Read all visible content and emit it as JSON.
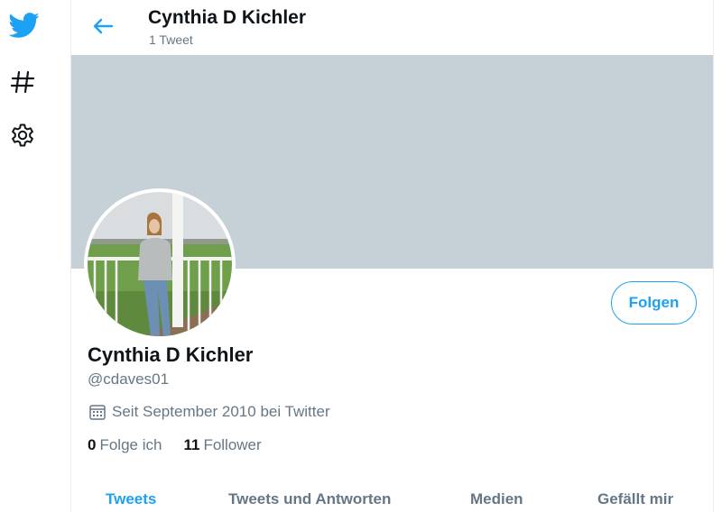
{
  "colors": {
    "accent": "#1da1f2",
    "banner": "#c6d0d7",
    "muted": "#657786",
    "text": "#0f1419"
  },
  "nav": [
    {
      "icon": "twitter-bird-icon"
    },
    {
      "icon": "hashtag-icon"
    },
    {
      "icon": "gear-icon"
    }
  ],
  "header": {
    "back_icon": "arrow-left-icon",
    "name": "Cynthia D Kichler",
    "tweet_count": "1 Tweet"
  },
  "profile": {
    "display_name": "Cynthia D Kichler",
    "handle": "@cdaves01",
    "joined_icon": "calendar-icon",
    "joined": "Seit September 2010 bei Twitter",
    "follow_label": "Folgen",
    "following_count": "0",
    "following_label": "Folge ich",
    "followers_count": "11",
    "followers_label": "Follower"
  },
  "tabs": [
    {
      "label": "Tweets",
      "active": true
    },
    {
      "label": "Tweets und Antworten",
      "active": false
    },
    {
      "label": "Medien",
      "active": false
    },
    {
      "label": "Gefällt mir",
      "active": false
    }
  ]
}
